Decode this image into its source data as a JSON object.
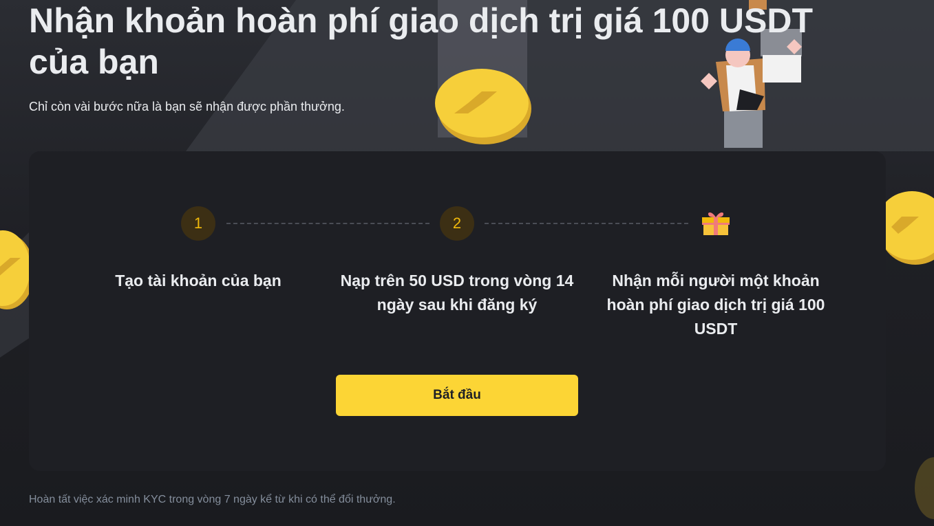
{
  "header": {
    "title": "Nhận khoản hoàn phí giao dịch trị giá 100 USDT của bạn",
    "subtitle": "Chỉ còn vài bước nữa là bạn sẽ nhận được phần thưởng."
  },
  "steps": [
    {
      "number": "1",
      "label": "Tạo tài khoản của bạn"
    },
    {
      "number": "2",
      "label": "Nạp trên 50 USD trong vòng 14 ngày sau khi đăng ký"
    },
    {
      "icon": "gift-icon",
      "label": "Nhận mỗi người một khoản hoàn phí giao dịch trị giá 100 USDT"
    }
  ],
  "cta": {
    "label": "Bắt đầu"
  },
  "footnote": "Hoàn tất việc xác minh KYC trong vòng 7 ngày kể từ khi có thể đổi thưởng.",
  "colors": {
    "accent": "#fcd535",
    "step_number": "#f0b90b",
    "card_background": "#1e1f24",
    "page_background": "#17181c"
  }
}
